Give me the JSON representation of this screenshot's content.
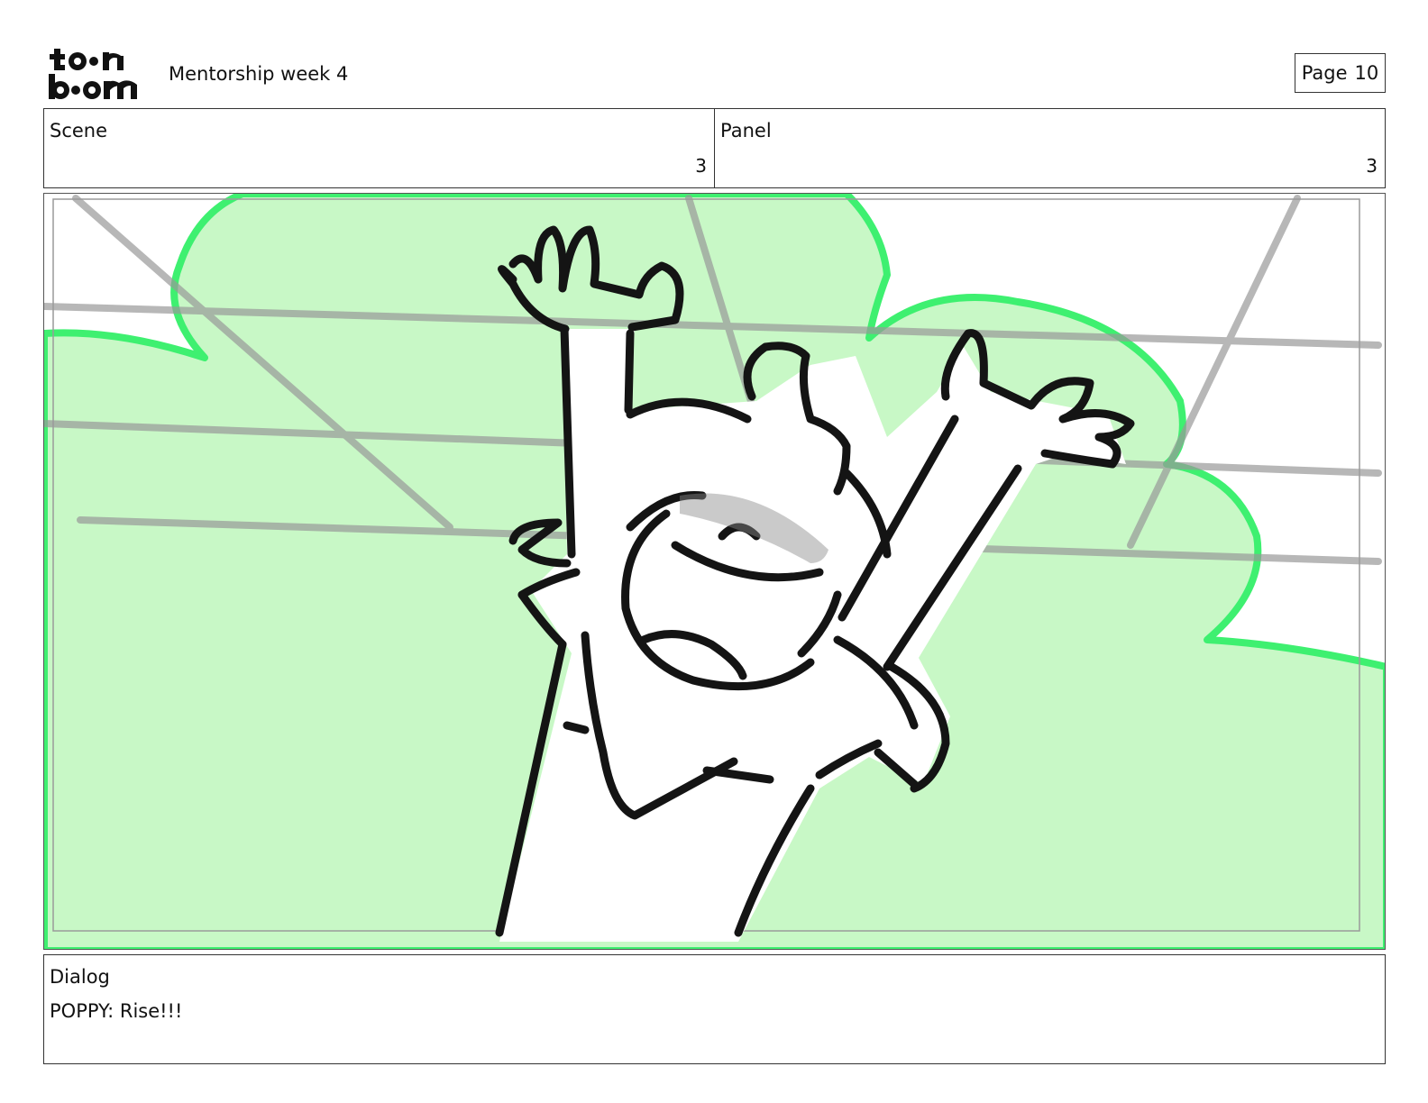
{
  "header": {
    "logo_text": "toon boom",
    "title": "Mentorship week 4",
    "page_label": "Page",
    "page_number": "10"
  },
  "scene": {
    "label": "Scene",
    "value": "3"
  },
  "panel": {
    "label": "Panel",
    "value": "3"
  },
  "dialog": {
    "label": "Dialog",
    "text": "POPPY: Rise!!!"
  },
  "colors": {
    "bush_fill": "#c8f8c6",
    "bush_outline": "#3ef070",
    "lines": "#a8a8a8",
    "ink": "#141414"
  }
}
